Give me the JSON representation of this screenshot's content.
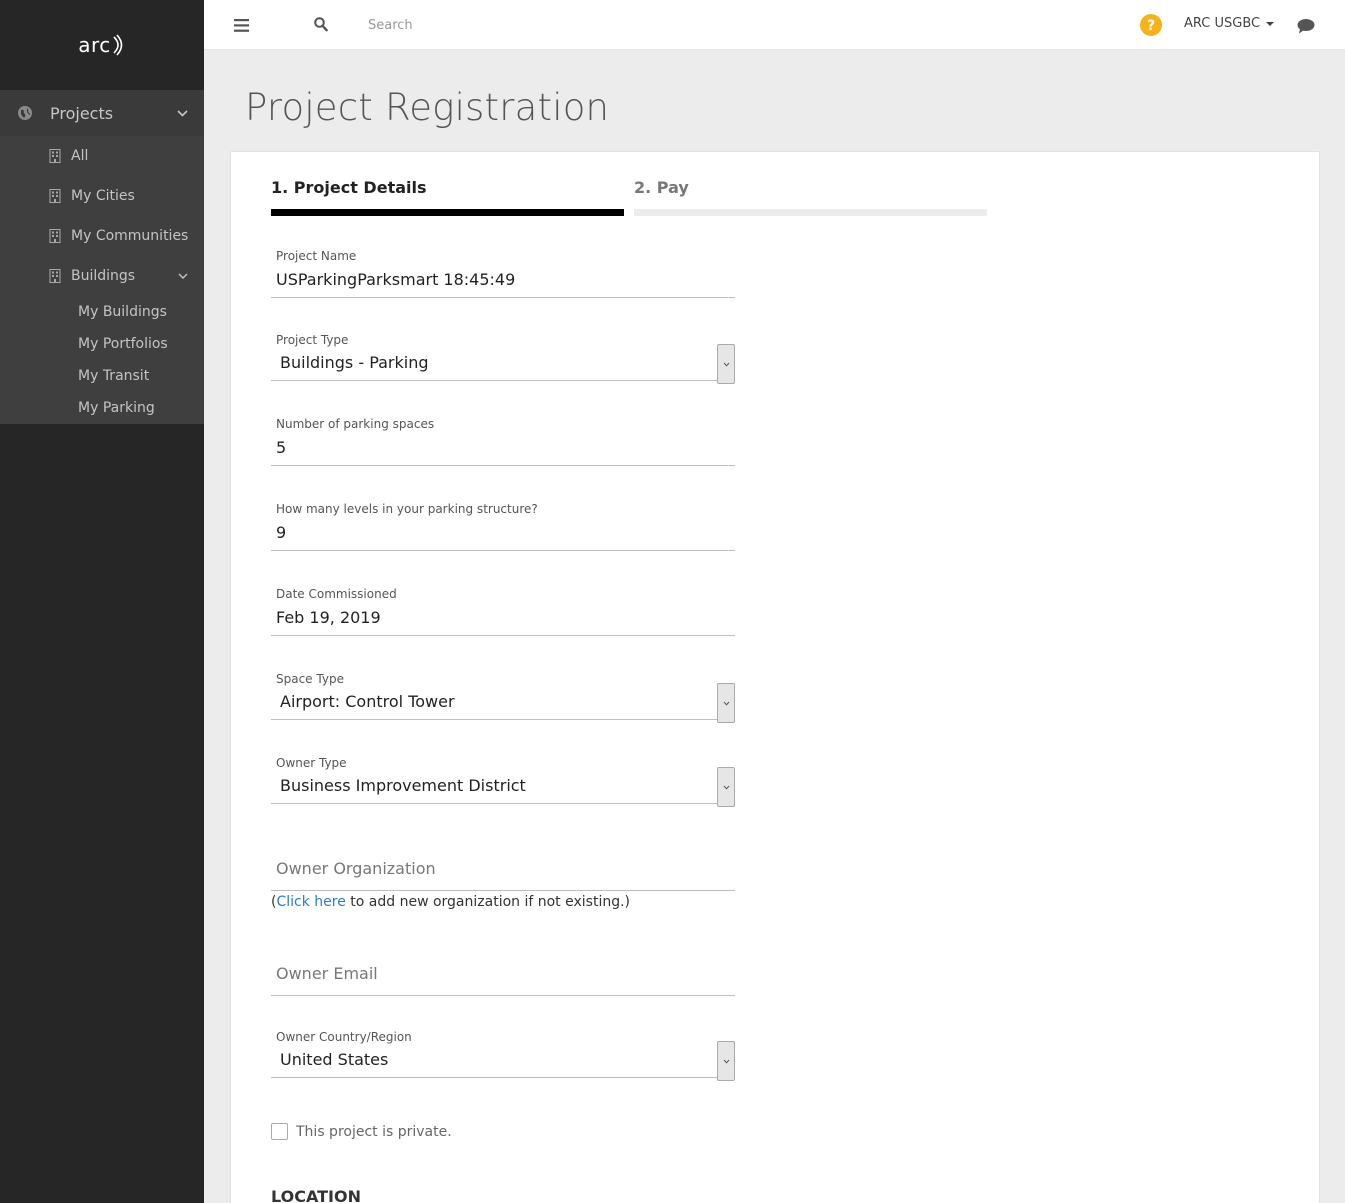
{
  "app": {
    "logo_text": "arc"
  },
  "sidebar": {
    "projects_label": "Projects",
    "items": [
      {
        "label": "All"
      },
      {
        "label": "My Cities"
      },
      {
        "label": "My Communities"
      },
      {
        "label": "Buildings"
      }
    ],
    "buildings_children": [
      {
        "label": "My Buildings"
      },
      {
        "label": "My Portfolios"
      },
      {
        "label": "My Transit"
      },
      {
        "label": "My Parking"
      }
    ]
  },
  "topbar": {
    "search_placeholder": "Search",
    "user_name": "ARC USGBC",
    "help_icon": "question-circle-icon",
    "chat_icon": "comment-icon",
    "help_color": "#f5b21b"
  },
  "page": {
    "title": "Project Registration"
  },
  "steps": [
    {
      "label": "1. Project Details",
      "active": true
    },
    {
      "label": "2. Pay",
      "active": false
    }
  ],
  "form": {
    "project_name": {
      "label": "Project Name",
      "value": "USParkingParksmart 18:45:49"
    },
    "project_type": {
      "label": "Project Type",
      "value": "Buildings - Parking"
    },
    "parking_spaces": {
      "label": "Number of parking spaces",
      "value": "5"
    },
    "parking_levels": {
      "label": "How many levels in your parking structure?",
      "value": "9"
    },
    "date_commissioned": {
      "label": "Date Commissioned",
      "value": "Feb 19, 2019"
    },
    "space_type": {
      "label": "Space Type",
      "value": "Airport: Control Tower"
    },
    "owner_type": {
      "label": "Owner Type",
      "value": "Business Improvement District"
    },
    "owner_org": {
      "placeholder": "Owner Organization"
    },
    "org_hint": {
      "open": "(",
      "link": "Click here",
      "rest": " to add new organization if not existing.)"
    },
    "owner_email": {
      "placeholder": "Owner Email"
    },
    "owner_country": {
      "label": "Owner Country/Region",
      "value": "United States"
    },
    "private_label": "This project is private.",
    "location_title": "LOCATION"
  }
}
